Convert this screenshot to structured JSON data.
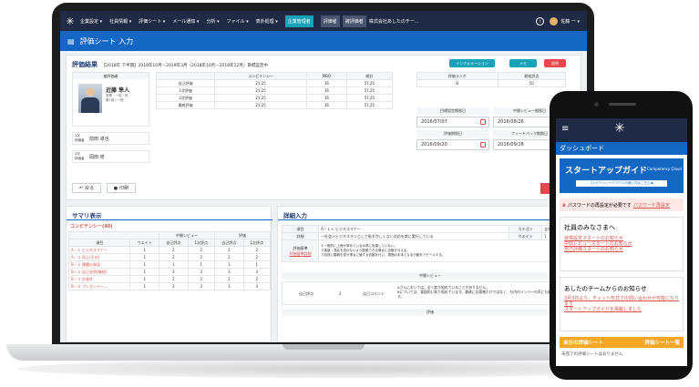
{
  "nav": {
    "menu": [
      "企業設定 ▾",
      "社員情報 ▾",
      "評価シート ▾",
      "メール通知 ▾",
      "分析 ▾",
      "ファイル ▾",
      "表外処理 ▾"
    ],
    "active": "企業管理者",
    "chips": [
      "評価者",
      "被評価者"
    ],
    "company": "株式会社あしたのチー...",
    "user": "佐藤 一 ▾",
    "info_icon": "info-icon"
  },
  "title": "評価シート 入力",
  "result": {
    "heading": "評価結果",
    "period": "【2018年 下半期】2018年10月－2019年3月（2018年10月－2018年12月）目標設定中",
    "buttons": {
      "info": "インフォメーション",
      "memo": "メモ",
      "help": "説明"
    },
    "evaluatee_label": "被評価者",
    "person_name": "近藤 隼人",
    "person_sub1": "営業・一般 / 西",
    "person_sub2": "第1部 / 一般",
    "eval1_label": "1次\n評価者",
    "eval1_name": "前田 卓也",
    "eval2_label": "2次\n評価者",
    "eval2_name": "岡田 修",
    "score_headers": [
      "",
      "コンピテンシー",
      "MBO",
      "総計"
    ],
    "score_rows": [
      [
        "自己評価",
        "21.25",
        "36",
        "57.25"
      ],
      [
        "1次評価",
        "21.25",
        "36",
        "57.25"
      ],
      [
        "2次評価",
        "21.25",
        "36",
        "57.25"
      ],
      [
        "最終評価",
        "21.25",
        "36",
        "57.25"
      ]
    ],
    "rank_label": "評価ランク",
    "rank_value": "B",
    "pay_label": "昇給評点",
    "pay_value": "50",
    "date_labels": [
      "目標設定期限日",
      "中間レビュー期限日",
      "評価期限日",
      "フィードバック期限日"
    ],
    "dates": [
      "2016/07/07",
      "2016/08/26",
      "2016/09/20",
      "2016/09/28"
    ],
    "back": "戻る",
    "print": "印刷",
    "save": "保存"
  },
  "summary": {
    "title": "サマリ表示",
    "section": "コンピテンシー(40)",
    "group1": "中間レビュー",
    "group2": "評価",
    "headers": [
      "項目",
      "ウエイト",
      "自己評点",
      "1次評点",
      "2次評点"
    ],
    "sub_headers": [
      "自己評点",
      "1次評点",
      "2次評点",
      "自己評点",
      "1次評点",
      "2次評点"
    ],
    "rows": [
      {
        "name": "A－１ ビジネスマナー",
        "w": "1",
        "vals": [
          "2",
          "2",
          "2",
          "2"
        ]
      },
      {
        "name": "A－２ 同上(その)",
        "w": "1",
        "vals": [
          "2",
          "2",
          "2",
          "2"
        ]
      },
      {
        "name": "B－１ 課題の発見",
        "w": "1",
        "vals": [
          "1",
          "1",
          "1",
          "1"
        ]
      },
      {
        "name": "B－２ 自己学習(継続)",
        "w": "1",
        "vals": [
          "3",
          "3",
          "3",
          "3"
        ]
      },
      {
        "name": "B－３ 計画性",
        "w": "1",
        "vals": [
          "2",
          "2",
          "2",
          "2"
        ]
      },
      {
        "name": "B－４ プレゼンテー...",
        "w": "1",
        "vals": [
          "3",
          "3",
          "3",
          "3"
        ]
      }
    ]
  },
  "detail": {
    "title": "詳細入力",
    "item_label": "項目",
    "item_value": "A－１ｅ ビジネスマナー",
    "category_label": "カテゴリ",
    "category_value": "全社共通",
    "desc_label": "詳細",
    "desc_value": "一社会人ビジネスマンとして恥ずかしくない対応を常に実行している",
    "weight_label": "ウエイト",
    "weight_value": "1",
    "criteria_label": "評価基準",
    "criteria_link": "評価基準詳細",
    "criteria_lines": [
      "１一般的に上席が求めている水準に到達していない。",
      "２迷惑・混乱を招かないよう配慮できる場合に合格を与える。",
      "３自然に模範を見せ得るに値する言動を行い、周囲の手本となる行動をアピールする。"
    ],
    "mid_review": "中間レビュー",
    "self_label": "自己評点",
    "self_value": "2",
    "comment_label": "自己コメント",
    "comment_lines": [
      "Aさんにおいては、全く取り組めていることがありません。",
      "Bについては、意図的に取り組めています。業務にお客様だけではなく、社内のメンバーの声にも取り組みたいです。"
    ],
    "eval": "評価"
  },
  "phone": {
    "dashboard": "ダッシュボード",
    "banner_title": "スタートアップガイド",
    "banner_sub": "Competency Cloud",
    "banner_note": "コンピテンシークラウドの使い方はこちら ▶",
    "alert": "パスワードの再設定が必要です",
    "alert_link": "パスワード再設定",
    "greet": "社員のみなさまへ",
    "greet_links": [
      "目標設定スタートのお知らせ",
      "中間レビュースタートのお知らせ",
      "自己評価スタートのお知らせ"
    ],
    "team_title": "あしたのチームからのお知らせ",
    "team_links": [
      "3月3日より、チャット形式での問い合わせが可能になります",
      "スタートアップガイドを掲載しました"
    ],
    "sheet_left": "自分の評価シート",
    "sheet_right": "評価シート一覧",
    "sheet_empty": "未完了の評価シートはありません"
  },
  "colors": {
    "navy": "#1f2a44",
    "blue": "#1468c4",
    "red": "#e8484d",
    "teal": "#17a2b8"
  }
}
